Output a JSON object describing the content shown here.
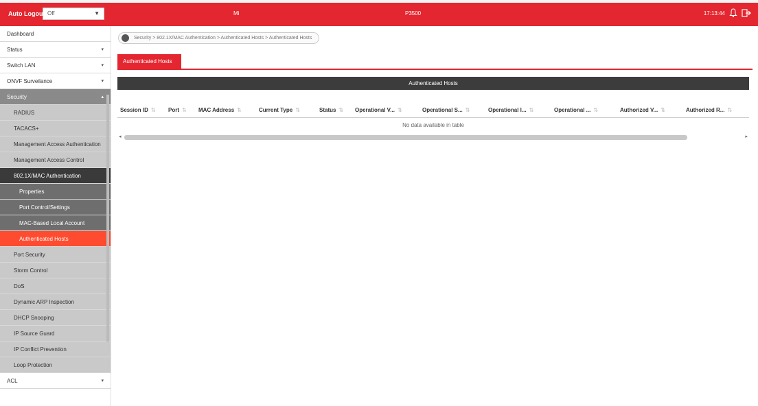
{
  "header": {
    "auto_logout_label": "Auto Logout",
    "auto_logout_value": "Off",
    "center_left": "Mi",
    "center_right": "P3500",
    "clock": "17:13:44",
    "bell_icon": "bell-icon",
    "logout_icon": "logout-icon",
    "brand_color": "#e3262f"
  },
  "sidebar": {
    "items": [
      {
        "label": "Dashboard",
        "chev": ""
      },
      {
        "label": "Status",
        "chev": "▾"
      },
      {
        "label": "Switch LAN",
        "chev": "▾"
      },
      {
        "label": "ONVF Surveilance",
        "chev": "▾"
      },
      {
        "label": "Security",
        "chev": "▴"
      },
      {
        "label": "RADIUS",
        "chev": ""
      },
      {
        "label": "TACACS+",
        "chev": ""
      },
      {
        "label": "Management Access Authentication",
        "chev": ""
      },
      {
        "label": "Management Access Control",
        "chev": ""
      },
      {
        "label": "802.1X/MAC Authentication",
        "chev": ""
      },
      {
        "label": "Properties",
        "chev": ""
      },
      {
        "label": "Port Control/Settings",
        "chev": ""
      },
      {
        "label": "MAC-Based Local Account",
        "chev": ""
      },
      {
        "label": "Authenticated Hosts",
        "chev": ""
      },
      {
        "label": "Port Security",
        "chev": ""
      },
      {
        "label": "Storm Control",
        "chev": ""
      },
      {
        "label": "DoS",
        "chev": ""
      },
      {
        "label": "Dynamic ARP Inspection",
        "chev": ""
      },
      {
        "label": "DHCP Snooping",
        "chev": ""
      },
      {
        "label": "IP Source Guard",
        "chev": ""
      },
      {
        "label": "IP Conflict Prevention",
        "chev": ""
      },
      {
        "label": "Loop Protection",
        "chev": ""
      },
      {
        "label": "ACL",
        "chev": "▾"
      }
    ]
  },
  "breadcrumb": "Security > 802.1X/MAC Authentication > Authenticated Hosts > Authenticated Hosts",
  "tab_label": "Authenticated Hosts",
  "panel_title": "Authenticated Hosts",
  "table": {
    "columns": [
      "Session ID",
      "Port",
      "MAC Address",
      "Current Type",
      "Status",
      "Operational V...",
      "Operational S...",
      "Operational I...",
      "Operational ...",
      "Authorized V...",
      "Authorized R..."
    ],
    "sort_glyph": "⇅",
    "empty_text": "No data available in table"
  },
  "scroll": {
    "left": "◂",
    "right": "▸"
  }
}
